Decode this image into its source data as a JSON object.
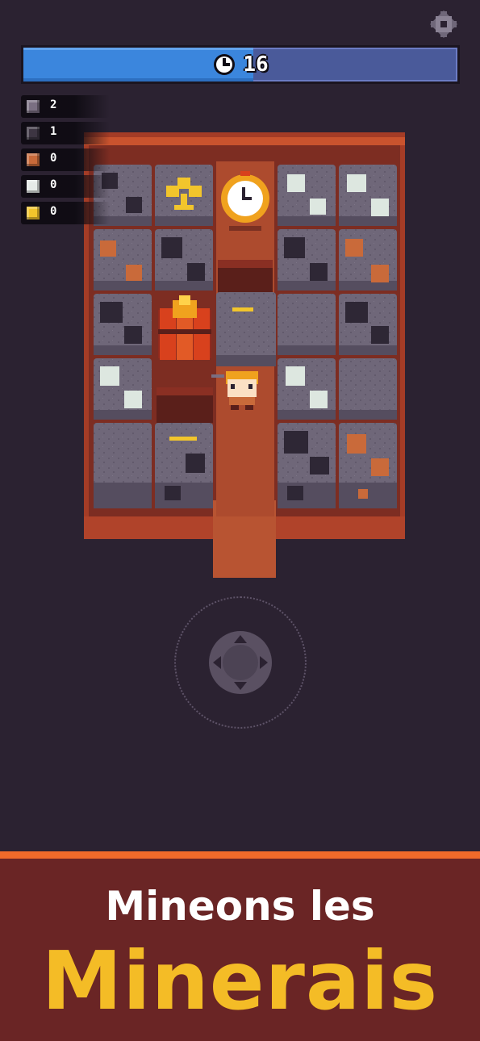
{
  "hud": {
    "timer": {
      "value": "16",
      "fraction": 0.53
    },
    "settings_icon": "gear-icon",
    "ores": [
      {
        "name": "stone",
        "count": "2",
        "color": "#7a6f82"
      },
      {
        "name": "coal",
        "count": "1",
        "color": "#3d3542"
      },
      {
        "name": "copper",
        "count": "0",
        "color": "#c96a3a"
      },
      {
        "name": "silver",
        "count": "0",
        "color": "#e6ebe8"
      },
      {
        "name": "gold",
        "count": "0",
        "color": "#f2c52c"
      }
    ]
  },
  "board": {
    "columns": 5,
    "rows": 5,
    "tiles": [
      [
        "coal",
        "trophy",
        "timer-pickup",
        "silver",
        "silver"
      ],
      [
        "copper",
        "coal",
        "empty",
        "coal",
        "copper"
      ],
      [
        "coal",
        "dynamite",
        "stone-dug",
        "stone",
        "coal"
      ],
      [
        "silver",
        "player",
        "player",
        "silver",
        "stone"
      ],
      [
        "stone",
        "coal",
        "path",
        "coal",
        "copper"
      ]
    ]
  },
  "controls": {
    "joystick_icon": "dpad-icon"
  },
  "banner": {
    "subtitle": "Mineons les",
    "title": "Minerais",
    "accent": "#f4bc26",
    "background": "#6a2525",
    "stripe": "#f06a2a"
  }
}
